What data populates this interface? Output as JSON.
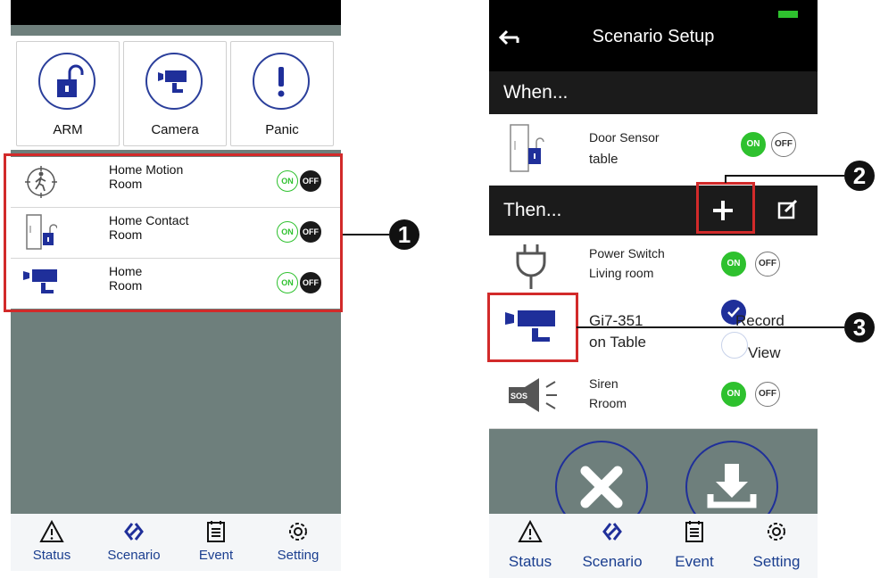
{
  "left": {
    "buttons": [
      {
        "label": "ARM",
        "icon": "lock-icon"
      },
      {
        "label": "Camera",
        "icon": "camera-icon"
      },
      {
        "label": "Panic",
        "icon": "panic-icon"
      }
    ],
    "devices": [
      {
        "name": "Home Motion",
        "room": "Room",
        "icon": "motion-sensor-icon",
        "on_label": "ON",
        "off_label": "OFF"
      },
      {
        "name": "Home Contact",
        "room": "Room",
        "icon": "door-sensor-icon",
        "on_label": "ON",
        "off_label": "OFF"
      },
      {
        "name": "Home",
        "room": "Room",
        "icon": "camera-icon",
        "on_label": "ON",
        "off_label": "OFF"
      }
    ],
    "tabs": [
      {
        "label": "Status",
        "icon": "warning-icon"
      },
      {
        "label": "Scenario",
        "icon": "scenario-icon"
      },
      {
        "label": "Event",
        "icon": "calendar-icon"
      },
      {
        "label": "Setting",
        "icon": "gear-icon"
      }
    ]
  },
  "callouts": [
    "1",
    "2",
    "3"
  ],
  "right": {
    "title": "Scenario Setup",
    "when_label": "When...",
    "then_label": "Then...",
    "when_item": {
      "name": "Door Sensor",
      "room": "table",
      "on_label": "ON",
      "off_label": "OFF"
    },
    "then_items": [
      {
        "name": "Power Switch",
        "room": "Living room",
        "on_label": "ON",
        "off_label": "OFF"
      },
      {
        "name": "Gi7-351",
        "room": "on Table",
        "option1": "Record",
        "option2": "View"
      },
      {
        "name": "Siren",
        "room": "Rroom",
        "on_label": "ON",
        "off_label": "OFF",
        "icon_text": "SOS"
      }
    ],
    "tabs": [
      {
        "label": "Status",
        "icon": "warning-icon"
      },
      {
        "label": "Scenario",
        "icon": "scenario-icon"
      },
      {
        "label": "Event",
        "icon": "calendar-icon"
      },
      {
        "label": "Setting",
        "icon": "gear-icon"
      }
    ]
  },
  "colors": {
    "accent_blue": "#1f2f9a",
    "on_green": "#2ec12e",
    "highlight_red": "#d22a2a",
    "panel_gray": "#6e7f7c"
  }
}
